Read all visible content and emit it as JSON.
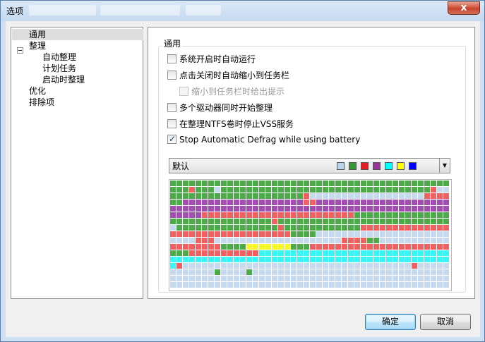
{
  "window": {
    "title": "选项",
    "close_glyph": "x"
  },
  "sidebar": {
    "items": [
      {
        "label": "通用",
        "selected": true
      },
      {
        "label": "整理",
        "expanded": true
      },
      {
        "label": "自动整理"
      },
      {
        "label": "计划任务"
      },
      {
        "label": "启动时整理"
      },
      {
        "label": "优化"
      },
      {
        "label": "排除项"
      }
    ]
  },
  "general": {
    "group_label": "通用",
    "options": [
      {
        "label": "系统开启时自动运行",
        "checked": false,
        "enabled": true
      },
      {
        "label": "点击关闭时自动缩小到任务栏",
        "checked": false,
        "enabled": true
      },
      {
        "label": "缩小到任务栏时给出提示",
        "checked": false,
        "enabled": false
      },
      {
        "label": "多个驱动器同时开始整理",
        "checked": false,
        "enabled": true
      },
      {
        "label": "在整理NTFS卷时停止VSS服务",
        "checked": false,
        "enabled": true
      },
      {
        "label": "Stop Automatic Defrag while using battery",
        "checked": true,
        "enabled": true
      }
    ],
    "color_scheme": {
      "selected": "默认",
      "swatches": [
        "#bcd4ee",
        "#339933",
        "#e51c23",
        "#993399",
        "#00ffff",
        "#ffff00",
        "#0000ff"
      ]
    },
    "map_colors": {
      "green": "#4caa48",
      "red": "#f06060",
      "purple": "#a24db0",
      "cyan": "#38f6f6",
      "yellow": "#f6f62a",
      "free": "#c6d9ef"
    }
  },
  "buttons": {
    "ok": "确定",
    "cancel": "取消"
  }
}
